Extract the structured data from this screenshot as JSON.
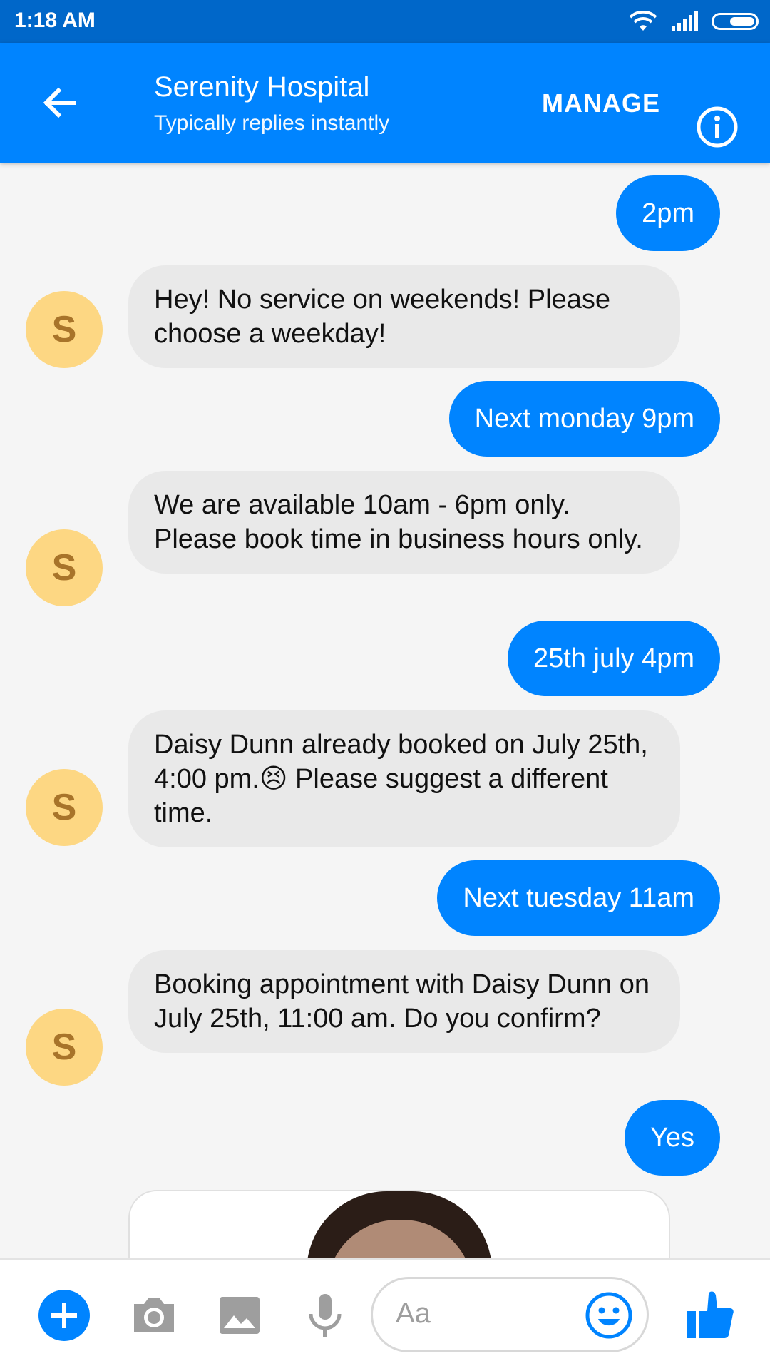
{
  "status_bar": {
    "time": "1:18 AM"
  },
  "header": {
    "title": "Serenity Hospital",
    "subtitle": "Typically replies instantly",
    "manage_label": "MANAGE"
  },
  "messages": [
    {
      "from": "me",
      "text": "2pm"
    },
    {
      "from": "bot",
      "avatar": "S",
      "text": "Hey! No service on weekends! Please choose a weekday!"
    },
    {
      "from": "me",
      "text": "Next monday 9pm"
    },
    {
      "from": "bot",
      "avatar": "S",
      "text": "We are available 10am - 6pm only. Please book time in business hours only."
    },
    {
      "from": "me",
      "text": "25th july 4pm"
    },
    {
      "from": "bot",
      "avatar": "S",
      "text_before_emoji": "Daisy Dunn already booked on July 25th, 4:00 pm.",
      "emoji": "😣",
      "text_after_emoji": " Please suggest a different time."
    },
    {
      "from": "me",
      "text": "Next tuesday 11am"
    },
    {
      "from": "bot",
      "avatar": "S",
      "text": "Booking appointment with Daisy Dunn on July 25th, 11:00 am. Do you confirm?"
    },
    {
      "from": "me",
      "text": "Yes"
    }
  ],
  "composer": {
    "placeholder": "Aa"
  },
  "colors": {
    "status_bar": "#0067c9",
    "header": "#0084ff",
    "outgoing_bubble": "#0084ff",
    "incoming_bubble": "#e9e9e9",
    "avatar": "#fdd783",
    "avatar_letter": "#a8742a"
  },
  "icons": [
    "back-arrow-icon",
    "info-icon",
    "wifi-icon",
    "signal-icon",
    "battery-icon",
    "plus-icon",
    "camera-icon",
    "image-icon",
    "microphone-icon",
    "emoji-icon",
    "thumbs-up-icon"
  ]
}
